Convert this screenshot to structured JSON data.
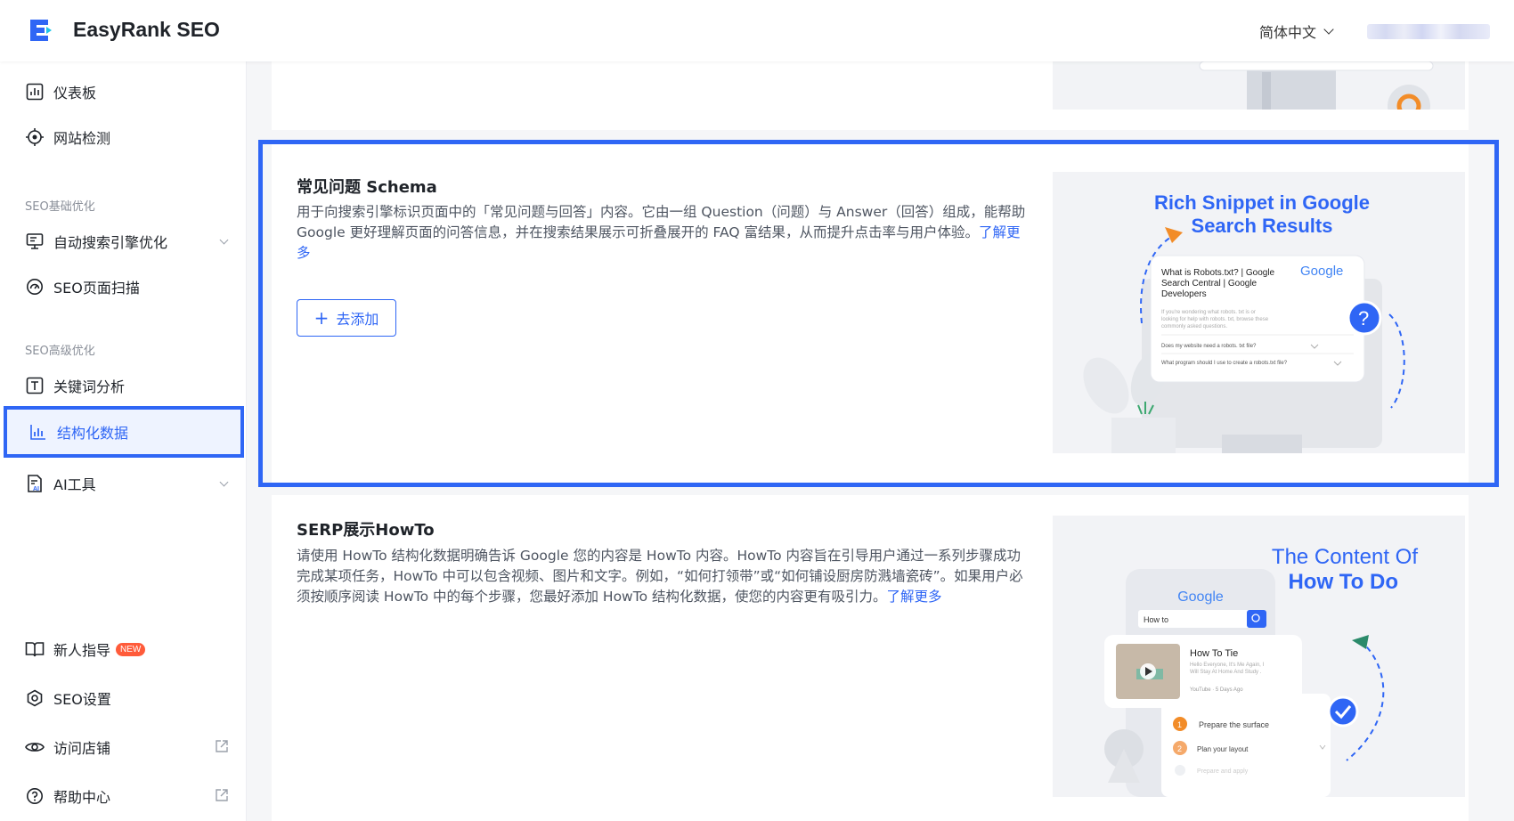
{
  "app": {
    "brand": "EasyRank SEO",
    "language": "简体中文"
  },
  "sidebar": {
    "items_top": [
      {
        "label": "仪表板",
        "icon": "dashboard-icon"
      },
      {
        "label": "网站检测",
        "icon": "target-icon"
      }
    ],
    "section_basic": "SEO基础优化",
    "items_basic": [
      {
        "label": "自动搜索引擎优化",
        "icon": "monitor-icon"
      },
      {
        "label": "SEO页面扫描",
        "icon": "gauge-icon"
      }
    ],
    "section_advanced": "SEO高级优化",
    "items_advanced": [
      {
        "label": "关键词分析",
        "icon": "text-box-icon"
      },
      {
        "label": "结构化数据",
        "icon": "chart-icon"
      },
      {
        "label": "AI工具",
        "icon": "ai-doc-icon"
      }
    ],
    "items_bottom": [
      {
        "label": "新人指导",
        "icon": "book-icon",
        "badge": "NEW"
      },
      {
        "label": "SEO设置",
        "icon": "settings-hex-icon"
      },
      {
        "label": "访问店铺",
        "icon": "eye-icon"
      },
      {
        "label": "帮助中心",
        "icon": "help-icon"
      }
    ]
  },
  "cards": {
    "faq": {
      "title": "常见问题 Schema",
      "desc": "用于向搜索引擎标识页面中的「常见问题与回答」内容。它由一组 Question（问题）与 Answer（回答）组成，能帮助 Google 更好理解页面的问答信息，并在搜索结果展示可折叠展开的 FAQ 富结果，从而提升点击率与用户体验。",
      "learn_more": "了解更多",
      "add_button": "去添加",
      "illus": {
        "heading_1": "Rich Snippet in Google",
        "heading_2": "Search Results",
        "google": "Google",
        "result_title_1": "What is Robots.txt? | Google",
        "result_title_2": "Search Central | Google",
        "result_title_3": "Developers",
        "snippet_1": "If you're wondering what robots. txt is or",
        "snippet_2": "looking for help with robots. txt, browse these",
        "snippet_3": "commonly asked questions.",
        "q1": "Does my website need a robots. txt file?",
        "q2": "What program should I use to create a robots.txt file?"
      }
    },
    "howto": {
      "title": "SERP展示HowTo",
      "desc": "请使用 HowTo 结构化数据明确告诉 Google 您的内容是 HowTo 内容。HowTo 内容旨在引导用户通过一系列步骤成功完成某项任务，HowTo 中可以包含视频、图片和文字。例如，“如何打领带”或“如何铺设厨房防溅墙瓷砖”。如果用户必须按顺序阅读 HowTo 中的每个步骤，您最好添加 HowTo 结构化数据，使您的内容更有吸引力。",
      "learn_more": "了解更多",
      "illus": {
        "heading_1": "The Content Of",
        "heading_2": "How To Do",
        "google": "Google",
        "search_text": "How to",
        "video_title": "How To Tie",
        "video_desc_1": "Hello Everyone, It's Me Again, I",
        "video_desc_2": "Will Stay At Home And Study .",
        "video_meta": "YouTube · 5 Days Ago",
        "step_1": "Prepare the surface",
        "step_2": "Plan your layout",
        "step_3": "Prepare and apply"
      }
    }
  },
  "colors": {
    "accent": "#2f66f5",
    "badge": "#ff5b3a",
    "orange": "#f28c28"
  }
}
